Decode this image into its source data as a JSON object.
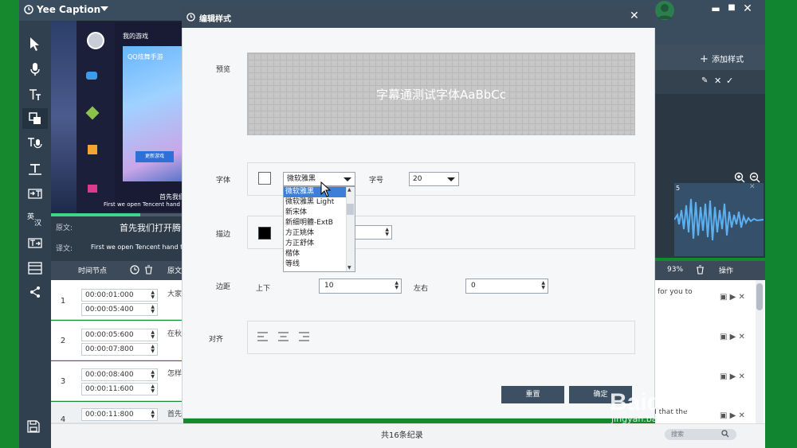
{
  "app": {
    "title": "Yee Caption"
  },
  "video": {
    "game_title": "我的游戏",
    "banner_text": "QQ炫舞手游",
    "banner_button": "更新游戏",
    "subtitle_cn": "首先我们",
    "subtitle_en": "First we open Tencent hand to"
  },
  "source_bar": {
    "source_label": "原文:",
    "source_text": "首先我们打开腾",
    "translation_label": "译文:",
    "translation_text": "First we open Tencent hand to"
  },
  "table": {
    "header_time": "时间节点",
    "header_source": "原文",
    "rows": [
      {
        "num": "1",
        "start": "00:00:01:000",
        "end": "00:00:05:400",
        "text": "大家"
      },
      {
        "num": "2",
        "start": "00:00:05:600",
        "end": "00:00:07:800",
        "text": "在秋"
      },
      {
        "num": "3",
        "start": "00:00:08:400",
        "end": "00:00:11:600",
        "text": "怎样"
      },
      {
        "num": "4",
        "start": "00:00:11:800",
        "end": "",
        "text": "首先"
      }
    ]
  },
  "right_panel": {
    "add_style": "添加样式",
    "wave_number": "5",
    "zoom_percent": "93%",
    "operations_label": "操作",
    "row1_text": "for you to",
    "row4_text": "d that the"
  },
  "status": {
    "record_count": "共16条纪录",
    "search_placeholder": "搜索"
  },
  "dialog": {
    "title": "编辑样式",
    "preview_label": "预览",
    "preview_text": "字幕通测试字体AaBbCc",
    "font_label": "字体",
    "font_value": "微软雅黑",
    "size_label": "字号",
    "size_value": "20",
    "stroke_label": "描边",
    "margin_label": "边距",
    "margin_vertical_label": "上下",
    "margin_vertical_value": "10",
    "margin_horizontal_label": "左右",
    "margin_horizontal_value": "0",
    "align_label": "对齐",
    "reset_button": "重置",
    "ok_button": "确定",
    "font_options": [
      "微软雅黑",
      "微软雅黑 Light",
      "新宋体",
      "新细明體-ExtB",
      "方正姚体",
      "方正舒体",
      "楷体",
      "等线"
    ]
  },
  "watermark": {
    "brand": "Baidu 经验",
    "url": "jingyan.baidu.com"
  },
  "colors": {
    "titlebar": "#3a4d5e",
    "toolbar": "#31404f",
    "accent_green": "#3ed68a",
    "selected_blue": "#3b7fd8"
  }
}
